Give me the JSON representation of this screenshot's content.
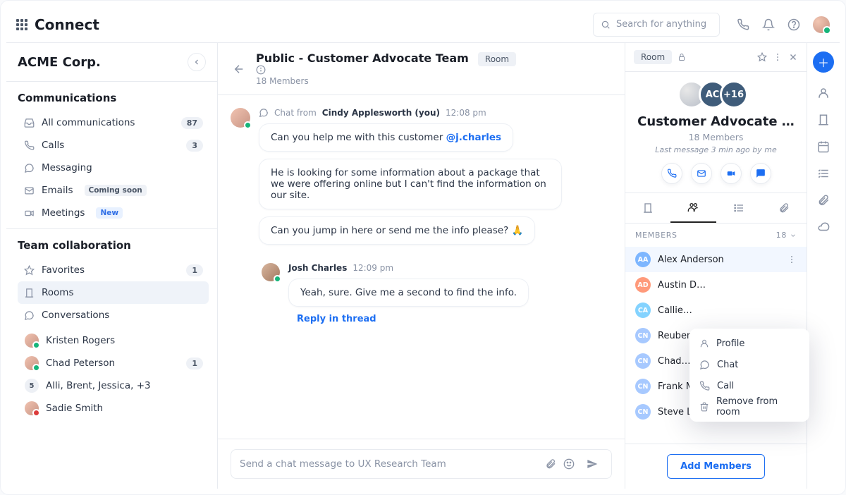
{
  "app": {
    "name": "Connect",
    "search_placeholder": "Search for anything"
  },
  "workspace": {
    "name": "ACME Corp."
  },
  "sidebar": {
    "comms_heading": "Communications",
    "items": [
      {
        "icon": "inbox",
        "label": "All communications",
        "badge": "87"
      },
      {
        "icon": "phone",
        "label": "Calls",
        "badge": "3"
      },
      {
        "icon": "chat",
        "label": "Messaging"
      },
      {
        "icon": "envelope",
        "label": "Emails",
        "pill": "Coming soon",
        "pill_style": "neutral"
      },
      {
        "icon": "video",
        "label": "Meetings",
        "pill": "New",
        "pill_style": "blue"
      }
    ],
    "team_heading": "Team collaboration",
    "team_items": [
      {
        "icon": "star",
        "label": "Favorites",
        "badge": "1"
      },
      {
        "icon": "building",
        "label": "Rooms",
        "active": true
      },
      {
        "icon": "chat",
        "label": "Conversations"
      }
    ],
    "conversations": [
      {
        "name": "Kristen Rogers",
        "status": "online"
      },
      {
        "name": "Chad Peterson",
        "status": "online",
        "badge": "1"
      },
      {
        "name": "Alli, Brent, Jessica, +3",
        "count": "5"
      },
      {
        "name": "Sadie Smith",
        "status": "busy"
      }
    ]
  },
  "chat": {
    "title": "Public - Customer Advocate Team",
    "chip": "Room",
    "subtitle": "18 Members",
    "threads": [
      {
        "from_prefix": "Chat from",
        "from": "Cindy Applesworth (you)",
        "time": "12:08 pm",
        "bubbles": [
          "Can you help me with this customer @j.charles",
          "He is looking for some information about a package that we were offering online but I can't find the information on our site.",
          "Can you jump in here or send me the info please? 🙏"
        ],
        "mention": "@j.charles"
      },
      {
        "from": "Josh Charles",
        "time": "12:09 pm",
        "bubbles": [
          "Yeah, sure. Give me a second to find the info."
        ]
      }
    ],
    "reply_in_thread": "Reply in thread",
    "composer_placeholder": "Send a chat message to UX Research Team"
  },
  "details": {
    "chip": "Room",
    "title": "Customer Advocate …",
    "members_label": "18 Members",
    "last_message": "Last message 3 min ago by me",
    "hero_chips": {
      "ac": "AC",
      "count": "+16"
    },
    "tabs": [
      "building",
      "members",
      "list",
      "attachments"
    ],
    "members_heading": "MEMBERS",
    "members_count": "18",
    "members": [
      {
        "initials": "AA",
        "color": "#7db6ff",
        "name": "Alex Anderson",
        "selected": true
      },
      {
        "initials": "AD",
        "color": "#ff9a7b",
        "name": "Austin D…"
      },
      {
        "initials": "CA",
        "color": "#84d3ff",
        "name": "Callie…"
      },
      {
        "initials": "CN",
        "color": "#a7c9ff",
        "name": "Reuben…"
      },
      {
        "initials": "CN",
        "color": "#a7c9ff",
        "name": "Chad…"
      },
      {
        "initials": "CN",
        "color": "#a7c9ff",
        "name": "Frank Meza"
      },
      {
        "initials": "CN",
        "color": "#a7c9ff",
        "name": "Steve Lowe"
      }
    ],
    "actions": [
      "phone",
      "envelope",
      "video",
      "chat"
    ],
    "add_members": "Add Members",
    "popover": [
      "Profile",
      "Chat",
      "Call",
      "Remove from room"
    ]
  }
}
